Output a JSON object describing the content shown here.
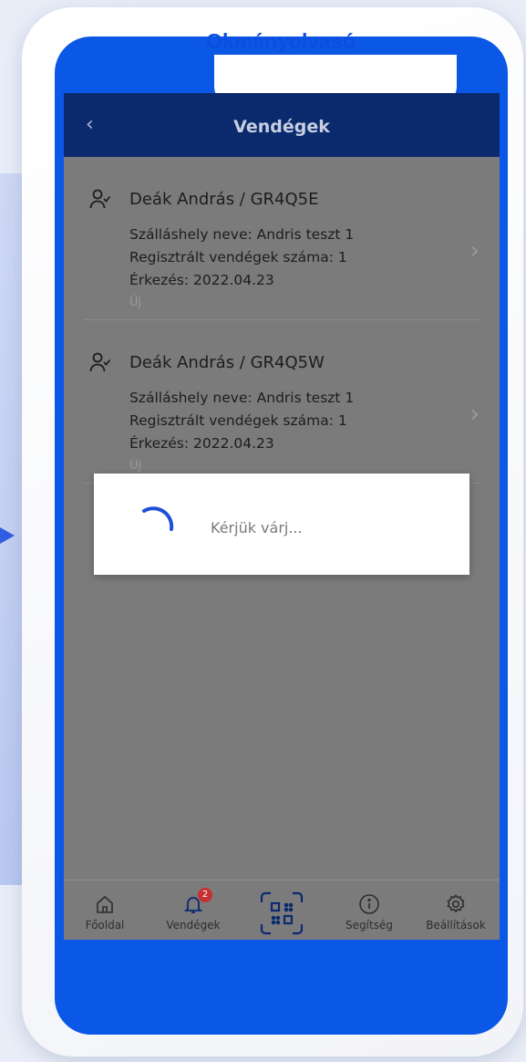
{
  "banner": {
    "title": "Okmányolvasó"
  },
  "header": {
    "title": "Vendégek",
    "back_icon": "chevron-left-icon"
  },
  "guests": [
    {
      "name": "Deák András / GR4Q5E",
      "accommodation": "Szálláshely neve: Andris teszt 1",
      "registered": "Regisztrált vendégek száma: 1",
      "arrival": "Érkezés: 2022.04.23",
      "status": "Új"
    },
    {
      "name": "Deák András / GR4Q5W",
      "accommodation": "Szálláshely neve: Andris teszt 1",
      "registered": "Regisztrált vendégek száma: 1",
      "arrival": "Érkezés: 2022.04.23",
      "status": "Új"
    }
  ],
  "dialog": {
    "text": "Kérjük várj..."
  },
  "tabs": [
    {
      "label": "Főoldal",
      "icon": "home-icon"
    },
    {
      "label": "Vendégek",
      "icon": "bell-icon",
      "badge": "2"
    },
    {
      "label": "",
      "icon": "qr-scan-icon"
    },
    {
      "label": "Segítség",
      "icon": "info-icon"
    },
    {
      "label": "Beállítások",
      "icon": "gear-icon"
    }
  ],
  "colors": {
    "brand_blue": "#0b57e6",
    "header_navy": "#0b2a6e",
    "overlay_gray": "#7b7b7b",
    "badge_red": "#c53030"
  }
}
